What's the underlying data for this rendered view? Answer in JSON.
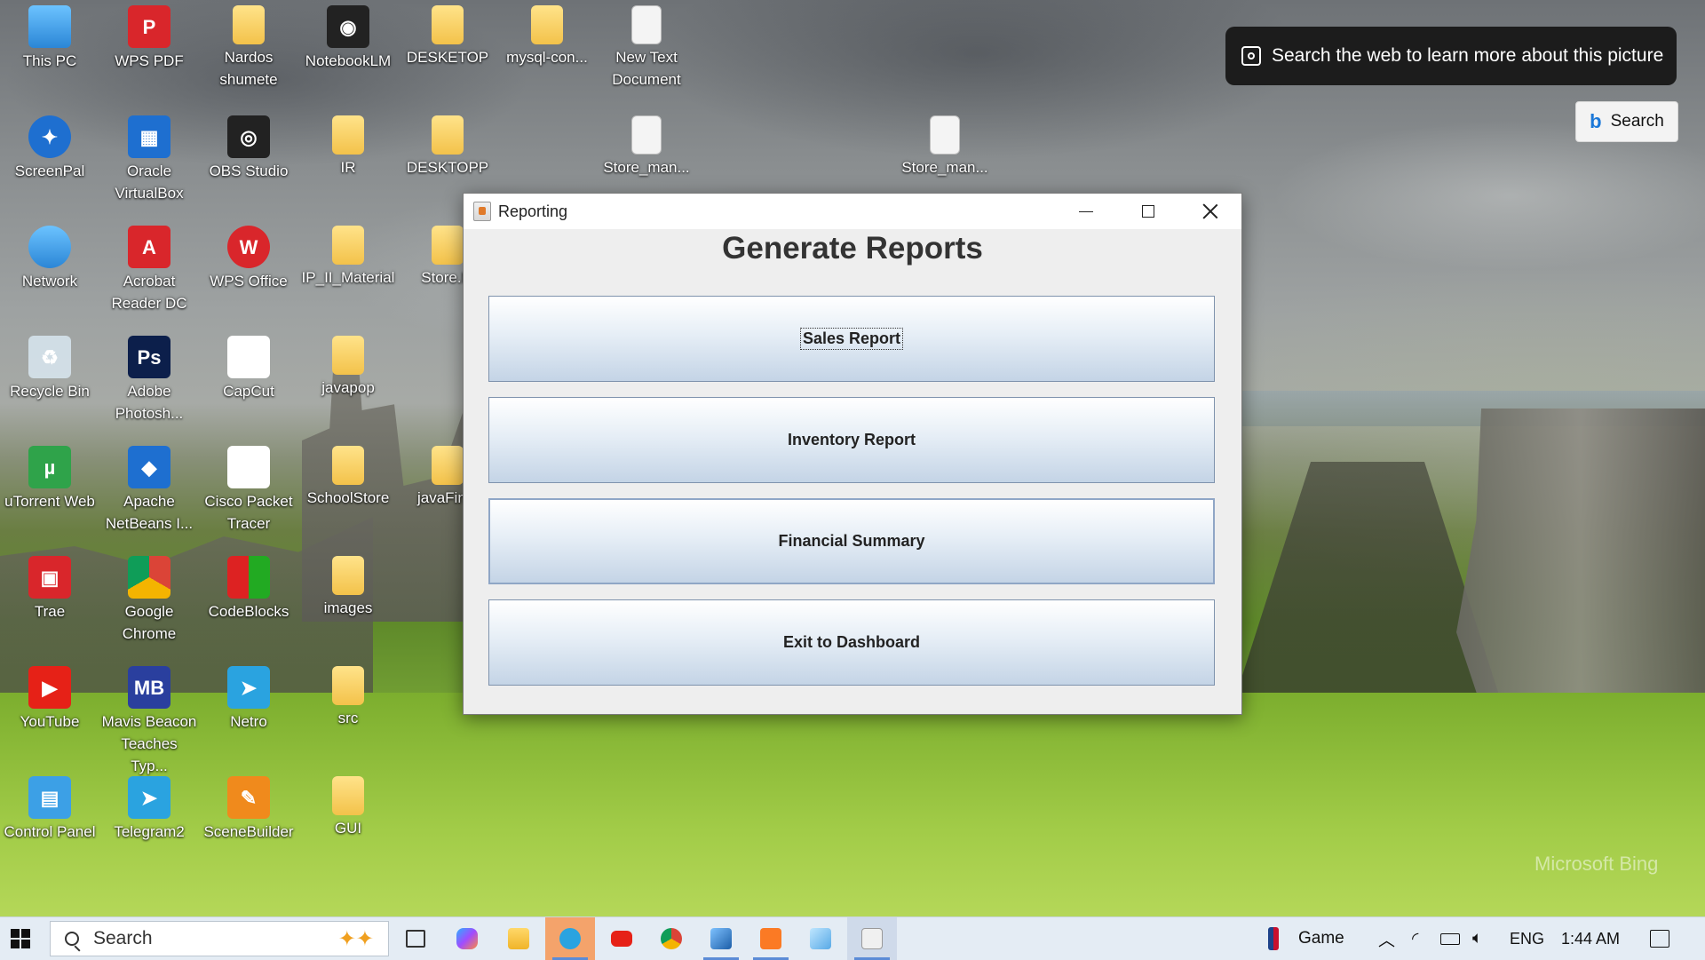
{
  "desktop_icons": [
    {
      "label": "This PC",
      "icon": "computer-icon"
    },
    {
      "label": "WPS PDF",
      "icon": "wps-pdf-icon"
    },
    {
      "label": "Nardos shumete",
      "icon": "user-folder-icon"
    },
    {
      "label": "NotebookLM",
      "icon": "notebooklm-icon"
    },
    {
      "label": "DESKETOP",
      "icon": "folder-icon"
    },
    {
      "label": "mysql-con...",
      "icon": "folder-icon"
    },
    {
      "label": "New Text Document",
      "icon": "text-document-icon"
    },
    {
      "label": "ScreenPal",
      "icon": "screenpal-icon"
    },
    {
      "label": "Oracle VirtualBox",
      "icon": "virtualbox-icon"
    },
    {
      "label": "OBS Studio",
      "icon": "obs-icon"
    },
    {
      "label": "IR",
      "icon": "folder-icon"
    },
    {
      "label": "DESKTOPP",
      "icon": "folder-icon"
    },
    {
      "label": "Store_man...",
      "icon": "text-document-icon"
    },
    {
      "label": "Store_man...",
      "icon": "text-document-icon"
    },
    {
      "label": "Network",
      "icon": "network-icon"
    },
    {
      "label": "Acrobat Reader DC",
      "icon": "acrobat-icon"
    },
    {
      "label": "WPS Office",
      "icon": "wps-office-icon"
    },
    {
      "label": "IP_II_Material",
      "icon": "folder-icon"
    },
    {
      "label": "Store.M",
      "icon": "folder-icon"
    },
    {
      "label": "Recycle Bin",
      "icon": "recycle-bin-icon"
    },
    {
      "label": "Adobe Photosh...",
      "icon": "photoshop-icon"
    },
    {
      "label": "CapCut",
      "icon": "capcut-icon"
    },
    {
      "label": "javapop",
      "icon": "folder-icon"
    },
    {
      "label": "uTorrent Web",
      "icon": "utorrent-icon"
    },
    {
      "label": "Apache NetBeans I...",
      "icon": "netbeans-icon"
    },
    {
      "label": "Cisco Packet Tracer",
      "icon": "packet-tracer-icon"
    },
    {
      "label": "SchoolStore",
      "icon": "folder-icon"
    },
    {
      "label": "javaFinal",
      "icon": "folder-icon"
    },
    {
      "label": "Trae",
      "icon": "trae-icon"
    },
    {
      "label": "Google Chrome",
      "icon": "chrome-icon"
    },
    {
      "label": "CodeBlocks",
      "icon": "codeblocks-icon"
    },
    {
      "label": "images",
      "icon": "folder-icon"
    },
    {
      "label": "YouTube",
      "icon": "youtube-icon"
    },
    {
      "label": "Mavis Beacon Teaches Typ...",
      "icon": "mavis-beacon-icon"
    },
    {
      "label": "Netro",
      "icon": "telegram-icon"
    },
    {
      "label": "src",
      "icon": "folder-icon"
    },
    {
      "label": "Control Panel",
      "icon": "control-panel-icon"
    },
    {
      "label": "Telegram2",
      "icon": "telegram-icon"
    },
    {
      "label": "SceneBuilder",
      "icon": "scenebuilder-icon"
    },
    {
      "label": "GUI",
      "icon": "folder-icon"
    }
  ],
  "bing": {
    "popup_text": "Search the web to learn more about this picture",
    "search_label": "Search",
    "watermark": "Microsoft Bing"
  },
  "window": {
    "title": "Reporting",
    "heading": "Generate Reports",
    "buttons": {
      "sales": "Sales Report",
      "inventory": "Inventory Report",
      "financial": "Financial Summary",
      "exit": "Exit to Dashboard"
    }
  },
  "taskbar": {
    "search_placeholder": "Search",
    "game_label": "Game",
    "language": "ENG",
    "time": "1:44 AM",
    "pinned": [
      "task-view-icon",
      "copilot-icon",
      "file-explorer-icon",
      "telegram-icon",
      "youtube-icon",
      "chrome-icon",
      "netbeans-icon",
      "xampp-icon",
      "notepad-icon",
      "java-app-icon"
    ]
  }
}
